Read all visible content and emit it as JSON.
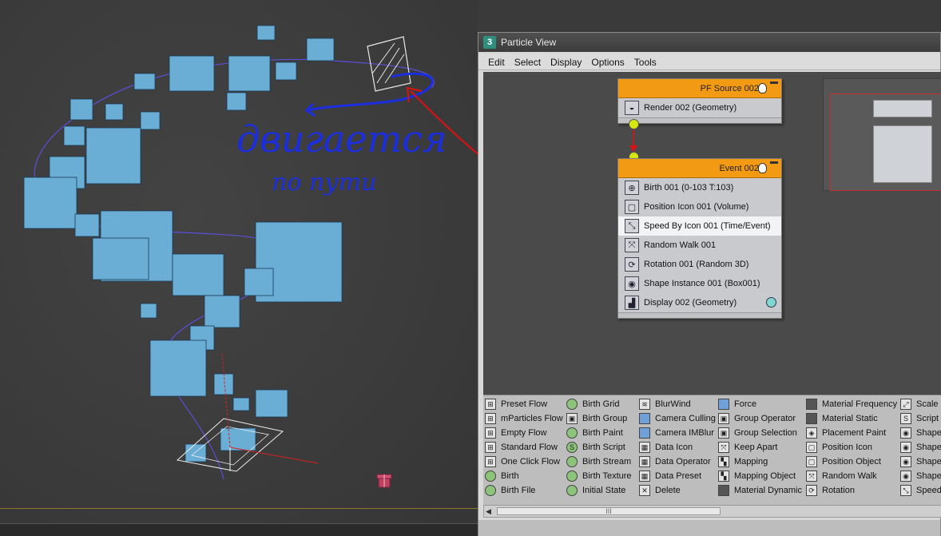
{
  "window": {
    "icon_text": "3",
    "title": "Particle View"
  },
  "menu": [
    "Edit",
    "Select",
    "Display",
    "Options",
    "Tools"
  ],
  "annotation": {
    "line1": "двигается",
    "line2": "по пути",
    "color": "#1a2ee0",
    "arrow_color": "#e01010"
  },
  "source_node": {
    "title": "PF Source 002",
    "operators": [
      {
        "icon": "teapot-icon",
        "label": "Render 002 (Geometry)"
      }
    ]
  },
  "event_node": {
    "title": "Event 002",
    "operators": [
      {
        "icon": "birth-icon",
        "label": "Birth 001 (0-103 T:103)"
      },
      {
        "icon": "position-icon",
        "label": "Position Icon 001 (Volume)"
      },
      {
        "icon": "speed-icon",
        "label": "Speed By Icon 001 (Time/Event)",
        "selected": true
      },
      {
        "icon": "random-walk-icon",
        "label": "Random Walk 001"
      },
      {
        "icon": "rotation-icon",
        "label": "Rotation 001 (Random 3D)"
      },
      {
        "icon": "shape-icon",
        "label": "Shape Instance 001 (Box001)"
      },
      {
        "icon": "display-icon",
        "label": "Display 002 (Geometry)"
      }
    ]
  },
  "depot": {
    "columns": [
      [
        "Preset Flow",
        "mParticles Flow",
        "Empty Flow",
        "Standard Flow",
        "One Click Flow",
        "Birth",
        "Birth File"
      ],
      [
        "Birth Grid",
        "Birth Group",
        "Birth Paint",
        "Birth Script",
        "Birth Stream",
        "Birth Texture",
        "Initial State"
      ],
      [
        "BlurWind",
        "Camera Culling",
        "Camera IMBlur",
        "Data Icon",
        "Data Operator",
        "Data Preset",
        "Delete"
      ],
      [
        "Force",
        "Group Operator",
        "Group Selection",
        "Keep Apart",
        "Mapping",
        "Mapping Object",
        "Material Dynamic"
      ],
      [
        "Material Frequency",
        "Material Static",
        "Placement Paint",
        "Position Icon",
        "Position Object",
        "Random Walk",
        "Rotation"
      ],
      [
        "Scale",
        "Script",
        "Shape",
        "Shape",
        "Shape",
        "Shape",
        "Speed"
      ]
    ]
  },
  "scrollbar": {
    "thumb_label": "III"
  }
}
